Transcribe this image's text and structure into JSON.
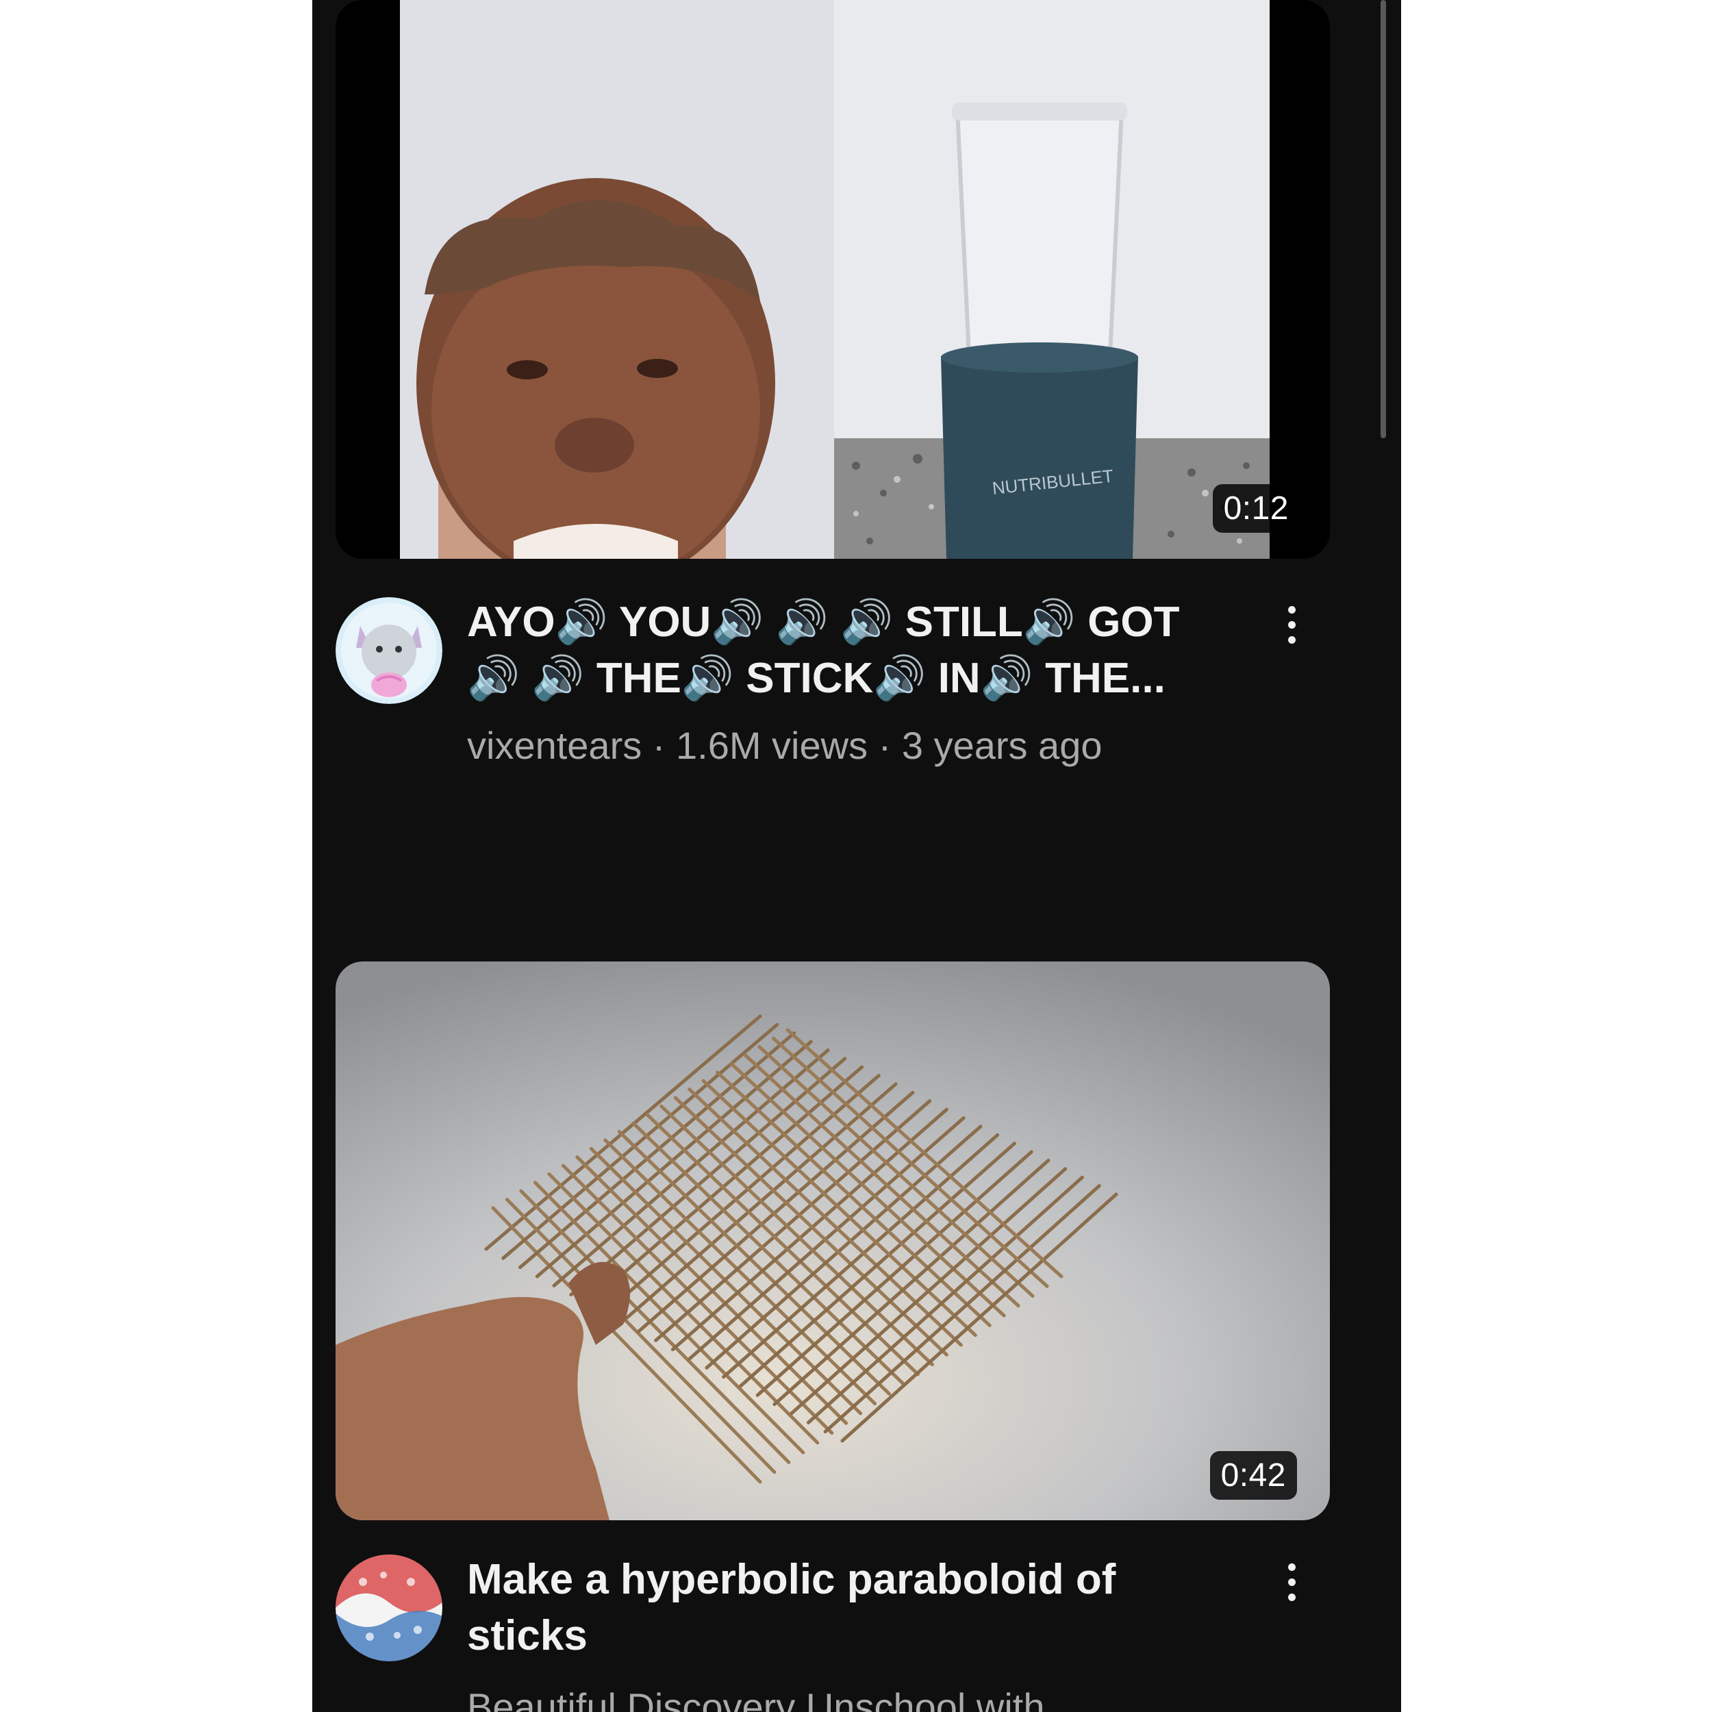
{
  "videos": [
    {
      "title": "AYO🔊 YOU🔊 🔊 🔊 STILL🔊 GOT 🔊 🔊 THE🔊 STICK🔊 IN🔊 THE...",
      "channel": "vixentears",
      "views": "1.6M views",
      "age": "3 years ago",
      "separator": " · ",
      "duration": "0:12",
      "thumbnail_icon": "man-with-blender-thumbnail",
      "avatar_icon": "cartoon-cat-avatar"
    },
    {
      "title": "Make a hyperbolic paraboloid of sticks",
      "channel_line": "Beautiful Discovery Unschool with",
      "duration": "0:42",
      "thumbnail_icon": "stick-grid-thumbnail",
      "avatar_icon": "geometric-pattern-avatar"
    }
  ],
  "colors": {
    "background": "#0f0f0f",
    "title": "#f1f1f1",
    "meta": "#aaaaaa",
    "duration_badge": "#000000"
  }
}
